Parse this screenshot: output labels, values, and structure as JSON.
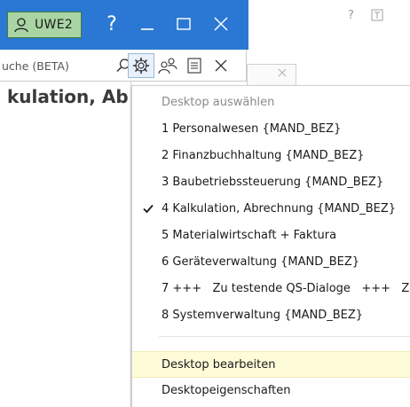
{
  "titlebar": {
    "user_label": "UWE2",
    "help_label": "?"
  },
  "background": {
    "help_label": "?"
  },
  "toolbar": {
    "search_placeholder": "uche (BETA)"
  },
  "page": {
    "heading": "kulation, Ab"
  },
  "menu": {
    "header": "Desktop auswählen",
    "items": [
      {
        "label": "1 Personalwesen {MAND_BEZ}",
        "checked": false
      },
      {
        "label": "2 Finanzbuchhaltung {MAND_BEZ}",
        "checked": false
      },
      {
        "label": "3 Baubetriebssteuerung {MAND_BEZ}",
        "checked": false
      },
      {
        "label": "4 Kalkulation, Abrechnung {MAND_BEZ}",
        "checked": true
      },
      {
        "label": "5 Materialwirtschaft + Faktura",
        "checked": false
      },
      {
        "label": "6 Geräteverwaltung {MAND_BEZ}",
        "checked": false
      },
      {
        "label": "7 +++   Zu testende QS-Dialoge   +++   Z",
        "checked": false
      },
      {
        "label": "8 Systemverwaltung {MAND_BEZ}",
        "checked": false
      }
    ],
    "actions": [
      {
        "label": "Desktop bearbeiten",
        "hover": true
      },
      {
        "label": "Desktopeigenschaften",
        "hover": false
      }
    ]
  },
  "colors": {
    "titlebar": "#2b78d4",
    "user_badge": "#a9d4a4",
    "hover_item": "#fefcd8"
  }
}
